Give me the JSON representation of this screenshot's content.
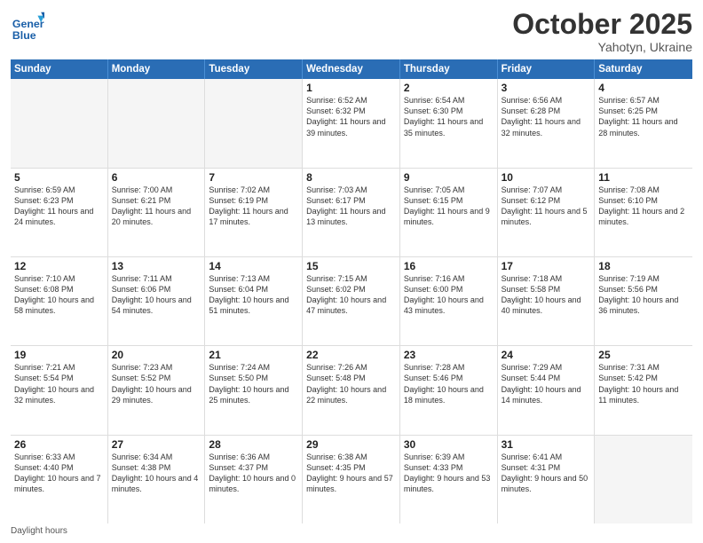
{
  "header": {
    "logo_general": "General",
    "logo_blue": "Blue",
    "month_title": "October 2025",
    "subtitle": "Yahotyn, Ukraine"
  },
  "days_of_week": [
    "Sunday",
    "Monday",
    "Tuesday",
    "Wednesday",
    "Thursday",
    "Friday",
    "Saturday"
  ],
  "weeks": [
    [
      {
        "day": "",
        "empty": true
      },
      {
        "day": "",
        "empty": true
      },
      {
        "day": "",
        "empty": true
      },
      {
        "day": "1",
        "sunrise": "6:52 AM",
        "sunset": "6:32 PM",
        "daylight": "11 hours and 39 minutes."
      },
      {
        "day": "2",
        "sunrise": "6:54 AM",
        "sunset": "6:30 PM",
        "daylight": "11 hours and 35 minutes."
      },
      {
        "day": "3",
        "sunrise": "6:56 AM",
        "sunset": "6:28 PM",
        "daylight": "11 hours and 32 minutes."
      },
      {
        "day": "4",
        "sunrise": "6:57 AM",
        "sunset": "6:25 PM",
        "daylight": "11 hours and 28 minutes."
      }
    ],
    [
      {
        "day": "5",
        "sunrise": "6:59 AM",
        "sunset": "6:23 PM",
        "daylight": "11 hours and 24 minutes."
      },
      {
        "day": "6",
        "sunrise": "7:00 AM",
        "sunset": "6:21 PM",
        "daylight": "11 hours and 20 minutes."
      },
      {
        "day": "7",
        "sunrise": "7:02 AM",
        "sunset": "6:19 PM",
        "daylight": "11 hours and 17 minutes."
      },
      {
        "day": "8",
        "sunrise": "7:03 AM",
        "sunset": "6:17 PM",
        "daylight": "11 hours and 13 minutes."
      },
      {
        "day": "9",
        "sunrise": "7:05 AM",
        "sunset": "6:15 PM",
        "daylight": "11 hours and 9 minutes."
      },
      {
        "day": "10",
        "sunrise": "7:07 AM",
        "sunset": "6:12 PM",
        "daylight": "11 hours and 5 minutes."
      },
      {
        "day": "11",
        "sunrise": "7:08 AM",
        "sunset": "6:10 PM",
        "daylight": "11 hours and 2 minutes."
      }
    ],
    [
      {
        "day": "12",
        "sunrise": "7:10 AM",
        "sunset": "6:08 PM",
        "daylight": "10 hours and 58 minutes."
      },
      {
        "day": "13",
        "sunrise": "7:11 AM",
        "sunset": "6:06 PM",
        "daylight": "10 hours and 54 minutes."
      },
      {
        "day": "14",
        "sunrise": "7:13 AM",
        "sunset": "6:04 PM",
        "daylight": "10 hours and 51 minutes."
      },
      {
        "day": "15",
        "sunrise": "7:15 AM",
        "sunset": "6:02 PM",
        "daylight": "10 hours and 47 minutes."
      },
      {
        "day": "16",
        "sunrise": "7:16 AM",
        "sunset": "6:00 PM",
        "daylight": "10 hours and 43 minutes."
      },
      {
        "day": "17",
        "sunrise": "7:18 AM",
        "sunset": "5:58 PM",
        "daylight": "10 hours and 40 minutes."
      },
      {
        "day": "18",
        "sunrise": "7:19 AM",
        "sunset": "5:56 PM",
        "daylight": "10 hours and 36 minutes."
      }
    ],
    [
      {
        "day": "19",
        "sunrise": "7:21 AM",
        "sunset": "5:54 PM",
        "daylight": "10 hours and 32 minutes."
      },
      {
        "day": "20",
        "sunrise": "7:23 AM",
        "sunset": "5:52 PM",
        "daylight": "10 hours and 29 minutes."
      },
      {
        "day": "21",
        "sunrise": "7:24 AM",
        "sunset": "5:50 PM",
        "daylight": "10 hours and 25 minutes."
      },
      {
        "day": "22",
        "sunrise": "7:26 AM",
        "sunset": "5:48 PM",
        "daylight": "10 hours and 22 minutes."
      },
      {
        "day": "23",
        "sunrise": "7:28 AM",
        "sunset": "5:46 PM",
        "daylight": "10 hours and 18 minutes."
      },
      {
        "day": "24",
        "sunrise": "7:29 AM",
        "sunset": "5:44 PM",
        "daylight": "10 hours and 14 minutes."
      },
      {
        "day": "25",
        "sunrise": "7:31 AM",
        "sunset": "5:42 PM",
        "daylight": "10 hours and 11 minutes."
      }
    ],
    [
      {
        "day": "26",
        "sunrise": "6:33 AM",
        "sunset": "4:40 PM",
        "daylight": "10 hours and 7 minutes."
      },
      {
        "day": "27",
        "sunrise": "6:34 AM",
        "sunset": "4:38 PM",
        "daylight": "10 hours and 4 minutes."
      },
      {
        "day": "28",
        "sunrise": "6:36 AM",
        "sunset": "4:37 PM",
        "daylight": "10 hours and 0 minutes."
      },
      {
        "day": "29",
        "sunrise": "6:38 AM",
        "sunset": "4:35 PM",
        "daylight": "9 hours and 57 minutes."
      },
      {
        "day": "30",
        "sunrise": "6:39 AM",
        "sunset": "4:33 PM",
        "daylight": "9 hours and 53 minutes."
      },
      {
        "day": "31",
        "sunrise": "6:41 AM",
        "sunset": "4:31 PM",
        "daylight": "9 hours and 50 minutes."
      },
      {
        "day": "",
        "empty": true
      }
    ]
  ],
  "footer": {
    "note": "Daylight hours"
  }
}
